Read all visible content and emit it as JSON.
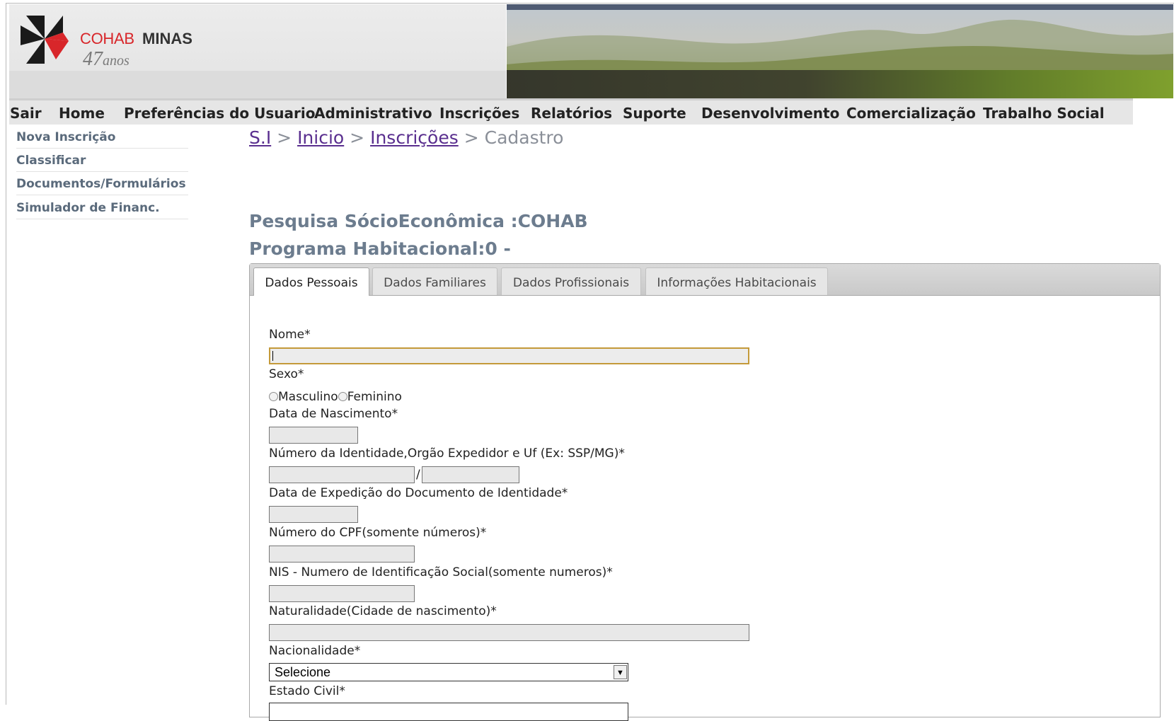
{
  "logo": {
    "brand_red": "COHAB",
    "brand_dark": "MINAS",
    "years_number": "47",
    "years_word": "anos"
  },
  "menu": [
    "Sair",
    "Home",
    "Preferências do Usuario",
    "Administrativo",
    "Inscrições",
    "Relatórios",
    "Suporte",
    "Desenvolvimento",
    "Comercialização",
    "Trabalho Social"
  ],
  "sidebar": [
    "Nova Inscrição",
    "Classificar",
    "Documentos/Formulários",
    "Simulador de Financ."
  ],
  "breadcrumb": {
    "items": [
      "S.I",
      "Inicio",
      "Inscrições",
      "Cadastro"
    ],
    "separator": ">"
  },
  "page_title": "Pesquisa SócioEconômica :COHAB",
  "program_title": "Programa Habitacional:0 -",
  "tabs": [
    "Dados Pessoais",
    "Dados Familiares",
    "Dados Profissionais",
    "Informações Habitacionais"
  ],
  "form": {
    "nome_label": "Nome*",
    "sexo_label": "Sexo*",
    "sexo_options": [
      "Masculino",
      "Feminino"
    ],
    "nascimento_label": "Data de Nascimento*",
    "identidade_label": "Número da Identidade,Orgão Expedidor e Uf (Ex: SSP/MG)*",
    "identidade_separator": "/",
    "expedicao_label": "Data de Expedição do Documento de Identidade*",
    "cpf_label": "Número do CPF(somente números)*",
    "nis_label": "NIS - Numero de Identificação Social(somente numeros)*",
    "naturalidade_label": "Naturalidade(Cidade de nascimento)*",
    "nacionalidade_label": "Nacionalidade*",
    "nacionalidade_value": "Selecione",
    "estado_civil_label": "Estado Civil*"
  },
  "colors": {
    "accent_red": "#d8262a",
    "link_purple": "#5a2f8f",
    "title_gray": "#6c7c8e",
    "focus_border": "#c49a3a"
  }
}
